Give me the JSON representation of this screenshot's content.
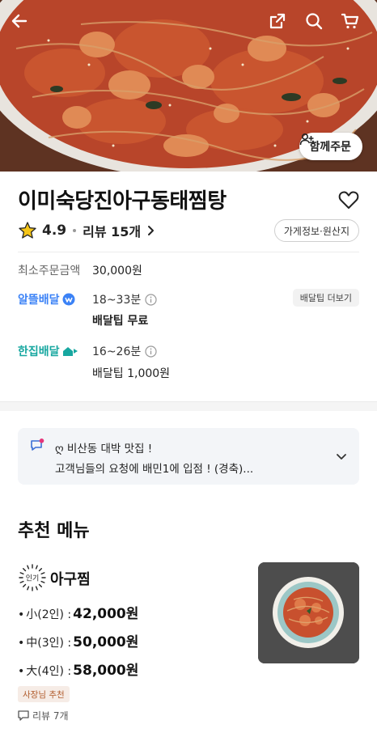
{
  "store": {
    "name": "이미숙당진아구동태찜탕",
    "rating": "4.9",
    "review_label": "리뷰 15개",
    "info_button": "가게정보·원산지",
    "group_order": "함께주문"
  },
  "order": {
    "min_label": "최소주문금액",
    "min_value": "30,000원"
  },
  "delivery": [
    {
      "name": "알뜰배달",
      "eta": "18~33분",
      "fee": "배달팁 무료",
      "color": "#3b82f6"
    },
    {
      "name": "한집배달",
      "eta": "16~26분",
      "fee": "배달팁 1,000원",
      "color": "#17a7a0"
    }
  ],
  "tip_more": "배달팁 더보기",
  "notice": {
    "line1": "ღ 비산동 대박 맛집 !",
    "line2": "고객님들의 요청에 배민1에 입점 ! (경축)..."
  },
  "recommend": {
    "title": "추천 메뉴",
    "badge": "인기",
    "item": {
      "name": "아구찜",
      "prices": [
        {
          "size": "小(2인) :",
          "price": "42,000원"
        },
        {
          "size": "中(3인) :",
          "price": "50,000원"
        },
        {
          "size": "大(4인) :",
          "price": "58,000원"
        }
      ],
      "tag": "사장님 추천",
      "reviews": "리뷰 7개"
    }
  },
  "icons": [
    "back-arrow-icon",
    "share-icon",
    "search-icon",
    "cart-icon",
    "heart-icon",
    "star-icon",
    "info-icon",
    "chevron-right-icon",
    "chevron-down-icon",
    "notice-icon",
    "group-add-icon",
    "comment-icon"
  ]
}
